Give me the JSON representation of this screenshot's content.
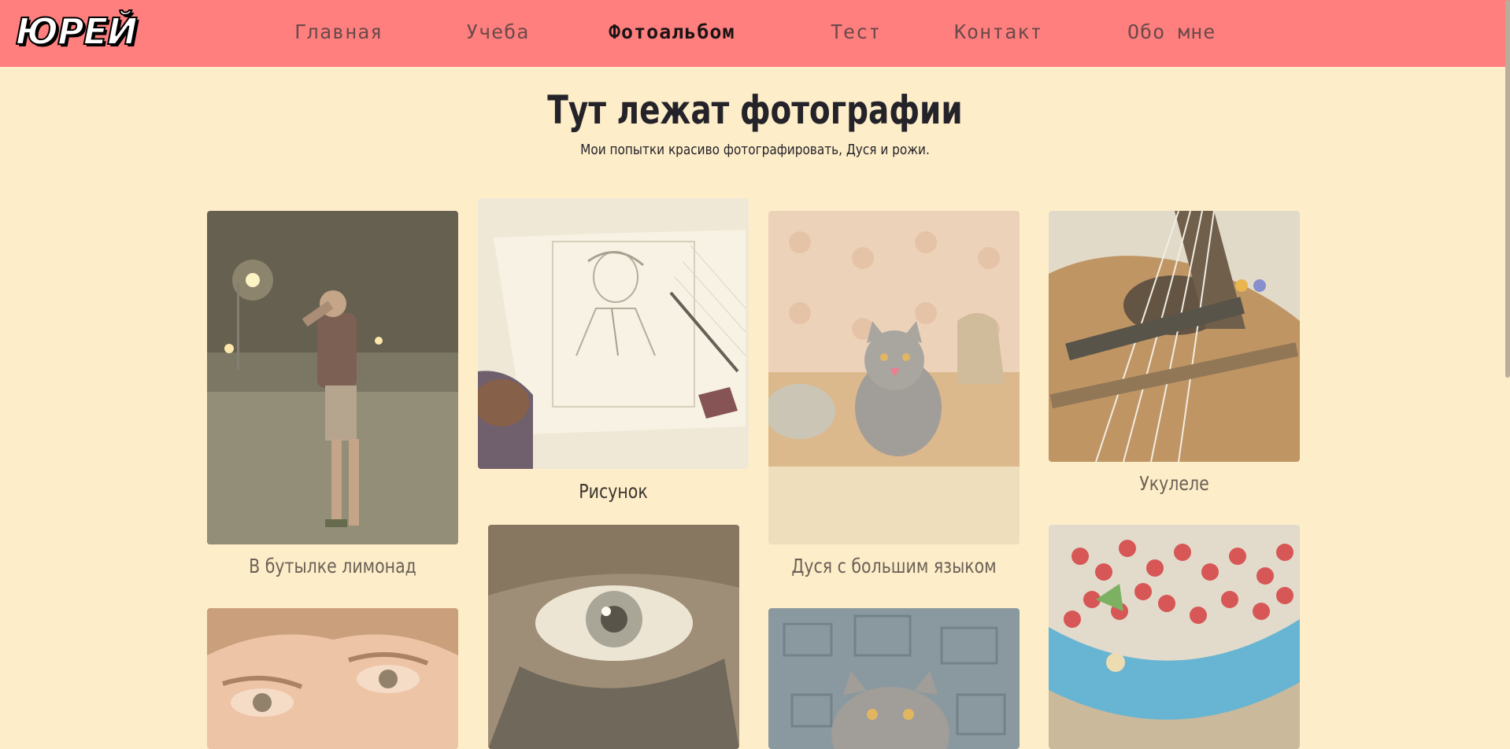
{
  "header": {
    "logo": "ЮРЕЙ",
    "nav": [
      {
        "label": "Главная",
        "active": false
      },
      {
        "label": "Учеба",
        "active": false
      },
      {
        "label": "Фотоальбом",
        "active": true
      },
      {
        "label": "Тест",
        "active": false
      },
      {
        "label": "Контакт",
        "active": false
      },
      {
        "label": "Обо мне",
        "active": false
      }
    ]
  },
  "main": {
    "title": "Тут лежат фотографии",
    "subtitle": "Мои попытки красиво фотографировать, Дуся и рожи."
  },
  "gallery": {
    "captions": {
      "bottle": "В бутылке лимонад",
      "drawing": "Рисунок",
      "cat": "Дуся с большим языком",
      "ukulele": "Укулеле"
    },
    "icons": {
      "bottle": "night-street-photo",
      "drawing": "sketchbook-photo",
      "cat": "cat-on-counter-photo",
      "ukulele": "ukulele-photo",
      "face": "face-closeup-photo",
      "eye": "eye-closeup-photo",
      "cat2": "cat-on-pillow-photo",
      "berries": "red-currants-photo"
    }
  },
  "colors": {
    "header": "#ff7f7f",
    "background": "#fdedc9",
    "nav_text": "#6c4a4a",
    "nav_active": "#1a1414"
  }
}
